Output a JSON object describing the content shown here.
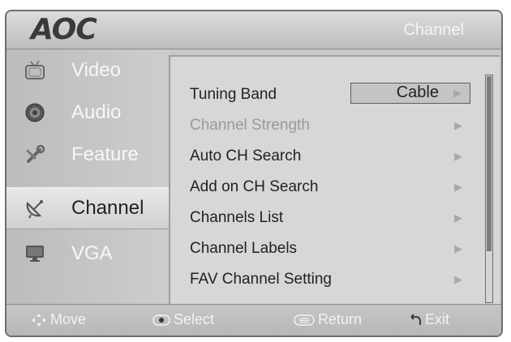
{
  "header": {
    "brand": "AOC",
    "title": "Channel"
  },
  "sidebar": {
    "items": [
      {
        "label": "Video",
        "icon": "tv-icon",
        "active": false
      },
      {
        "label": "Audio",
        "icon": "speaker-icon",
        "active": false
      },
      {
        "label": "Feature",
        "icon": "wrench-icon",
        "active": false
      },
      {
        "label": "Channel",
        "icon": "satellite-dish-icon",
        "active": true
      },
      {
        "label": "VGA",
        "icon": "monitor-icon",
        "active": false
      }
    ]
  },
  "menu": {
    "rows": [
      {
        "label": "Tuning Band",
        "value": "Cable",
        "enabled": true
      },
      {
        "label": "Channel Strength",
        "enabled": false
      },
      {
        "label": "Auto CH Search",
        "enabled": true
      },
      {
        "label": "Add on CH Search",
        "enabled": true
      },
      {
        "label": "Channels List",
        "enabled": true
      },
      {
        "label": "Channel Labels",
        "enabled": true
      },
      {
        "label": "FAV Channel Setting",
        "enabled": true
      }
    ],
    "arrow_glyph": "▶"
  },
  "footer": {
    "move": "Move",
    "select": "Select",
    "return": "Return",
    "exit": "Exit"
  },
  "colors": {
    "panel": "#c9c9c9",
    "content": "#d7d7d7",
    "active_item": "#e0e0e0",
    "text_dark": "#222222",
    "text_light": "#f7f7f7",
    "text_disabled": "#9a9a9a"
  }
}
